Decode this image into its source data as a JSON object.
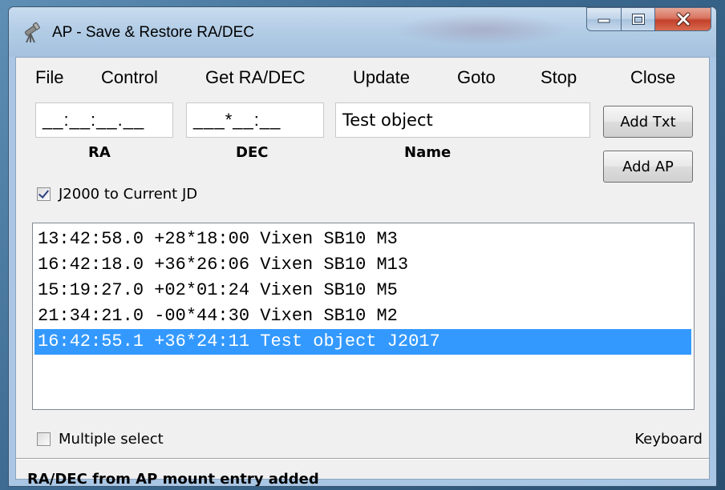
{
  "window": {
    "title": "AP - Save & Restore RA/DEC"
  },
  "menu": {
    "items": [
      "File",
      "Control",
      "Get RA/DEC",
      "Update",
      "Goto",
      "Stop",
      "Close"
    ]
  },
  "fields": {
    "ra_value": "__:__:__.__",
    "dec_value": "___*__:__",
    "name_value": "Test object",
    "ra_label": "RA",
    "dec_label": "DEC",
    "name_label": "Name"
  },
  "buttons": {
    "add_txt": "Add Txt",
    "add_ap": "Add AP"
  },
  "options": {
    "j2000_label": "J2000 to Current JD",
    "j2000_checked": true,
    "multiple_select_label": "Multiple select",
    "multiple_select_checked": false,
    "keyboard_label": "Keyboard"
  },
  "list": {
    "items": [
      "13:42:58.0 +28*18:00 Vixen SB10 M3",
      "16:42:18.0 +36*26:06 Vixen SB10 M13",
      "15:19:27.0 +02*01:24 Vixen SB10 M5",
      "21:34:21.0 -00*44:30 Vixen SB10 M2",
      "16:42:55.1 +36*24:11 Test object J2017"
    ],
    "selected_index": 4
  },
  "status": {
    "text": "RA/DEC from AP mount entry added"
  },
  "colors": {
    "selection": "#3399ff",
    "close_button": "#c2402a"
  }
}
